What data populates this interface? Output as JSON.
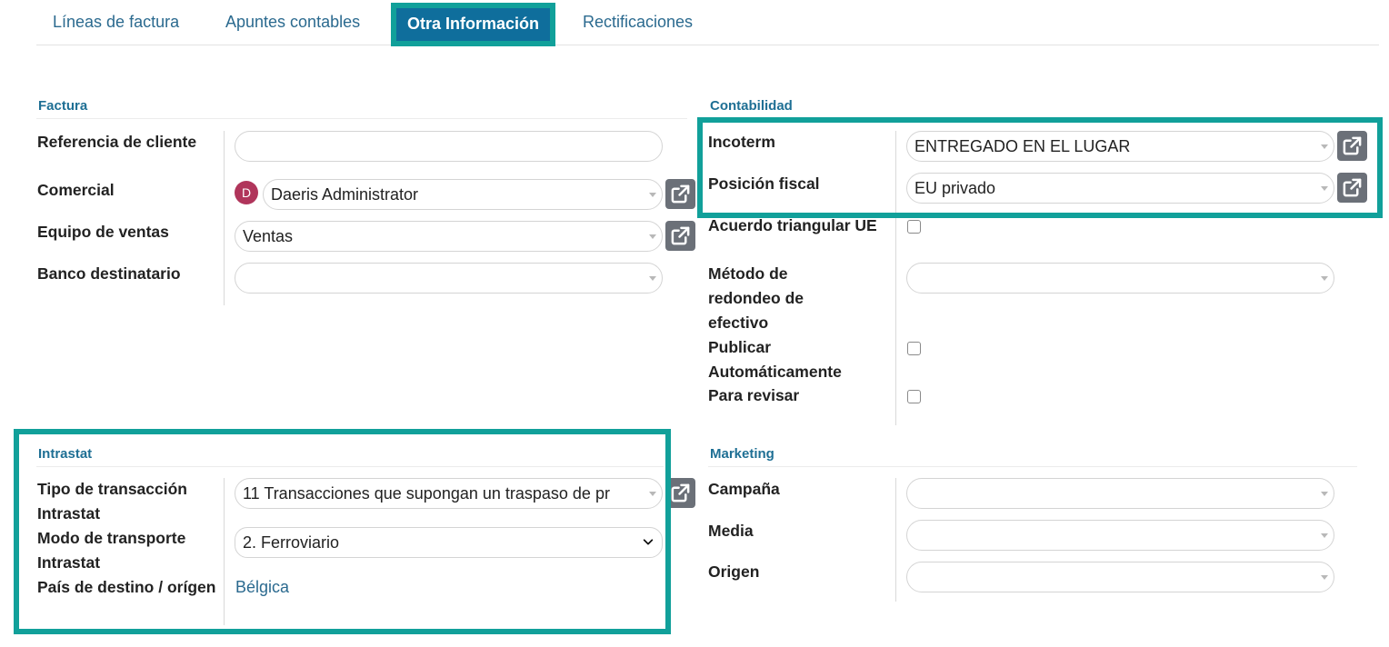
{
  "tabs": [
    {
      "label": "Líneas de factura"
    },
    {
      "label": "Apuntes contables"
    },
    {
      "label": "Otra Información"
    },
    {
      "label": "Rectificaciones"
    }
  ],
  "factura": {
    "title": "Factura",
    "referencia_label": "Referencia de cliente",
    "referencia_value": "",
    "comercial_label": "Comercial",
    "comercial_avatar": "D",
    "comercial_value": "Daeris Administrator",
    "equipo_label": "Equipo de ventas",
    "equipo_value": "Ventas",
    "banco_label": "Banco destinatario",
    "banco_value": ""
  },
  "contabilidad": {
    "title": "Contabilidad",
    "incoterm_label": "Incoterm",
    "incoterm_value": "ENTREGADO EN EL LUGAR",
    "posicion_label": "Posición fiscal",
    "posicion_value": "EU privado",
    "triangular_label": "Acuerdo triangular UE",
    "triangular_checked": false,
    "redondeo_label": "Método de redondeo de efectivo",
    "redondeo_value": "",
    "publicar_label": "Publicar Automáticamente",
    "publicar_checked": false,
    "revisar_label": "Para revisar",
    "revisar_checked": false
  },
  "intrastat": {
    "title": "Intrastat",
    "tipo_label": "Tipo de transacción Intrastat",
    "tipo_value": "11 Transacciones que supongan un traspaso de pr",
    "modo_label": "Modo de transporte Intrastat",
    "modo_value": "2. Ferroviario",
    "pais_label": "País de destino / orígen",
    "pais_value": "Bélgica"
  },
  "marketing": {
    "title": "Marketing",
    "campana_label": "Campaña",
    "campana_value": "",
    "media_label": "Media",
    "media_value": "",
    "origen_label": "Origen",
    "origen_value": ""
  },
  "colors": {
    "highlight": "#11a09a",
    "accent": "#1e6f94",
    "active_tab": "#0f6e9c",
    "external_button": "#6b7078",
    "avatar": "#b0355b"
  },
  "icons": {
    "external": "external-link-icon",
    "dropdown": "caret-down-icon"
  }
}
